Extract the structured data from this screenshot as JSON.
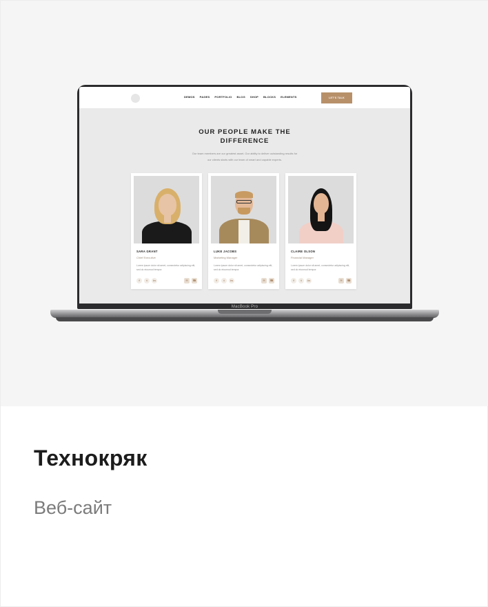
{
  "screenshot": {
    "device_label": "MacBook Pro",
    "site": {
      "nav": [
        "DEMOS",
        "PAGES",
        "PORTFOLIO",
        "BLOG",
        "SHOP",
        "BLOCKS",
        "ELEMENTS"
      ],
      "cta_label": "LET'S TALK",
      "heading_line1": "OUR PEOPLE MAKE THE",
      "heading_line2": "DIFFERENCE",
      "subtitle_line1": "Our team members are our greatest asset. Our ability to deliver outstanding results for",
      "subtitle_line2": "our clients starts with our team of smart and capable experts.",
      "members": [
        {
          "name": "SARA GRANT",
          "role": "Chief Executive",
          "bio": "Lorem ipsum dolor sit amet, consectetur adipiscing elit, sed do eiusmod tempor."
        },
        {
          "name": "LUKE JACOBS",
          "role": "Marketing Manager",
          "bio": "Lorem ipsum dolor sit amet, consectetur adipiscing elit, sed do eiusmod tempor."
        },
        {
          "name": "CLAIRE OLSON",
          "role": "Financial Manager",
          "bio": "Lorem ipsum dolor sit amet, consectetur adipiscing elit, sed do eiusmod tempor."
        }
      ]
    }
  },
  "caption": {
    "title": "Технокряк",
    "subtitle": "Веб-сайт"
  },
  "colors": {
    "accent": "#b7906a",
    "preview_bg": "#f5f5f5",
    "title": "#1c1c1c",
    "subtitle": "#7b7b7b"
  },
  "icons": [
    "facebook-icon",
    "twitter-icon",
    "linkedin-icon",
    "mail-icon",
    "phone-icon"
  ]
}
